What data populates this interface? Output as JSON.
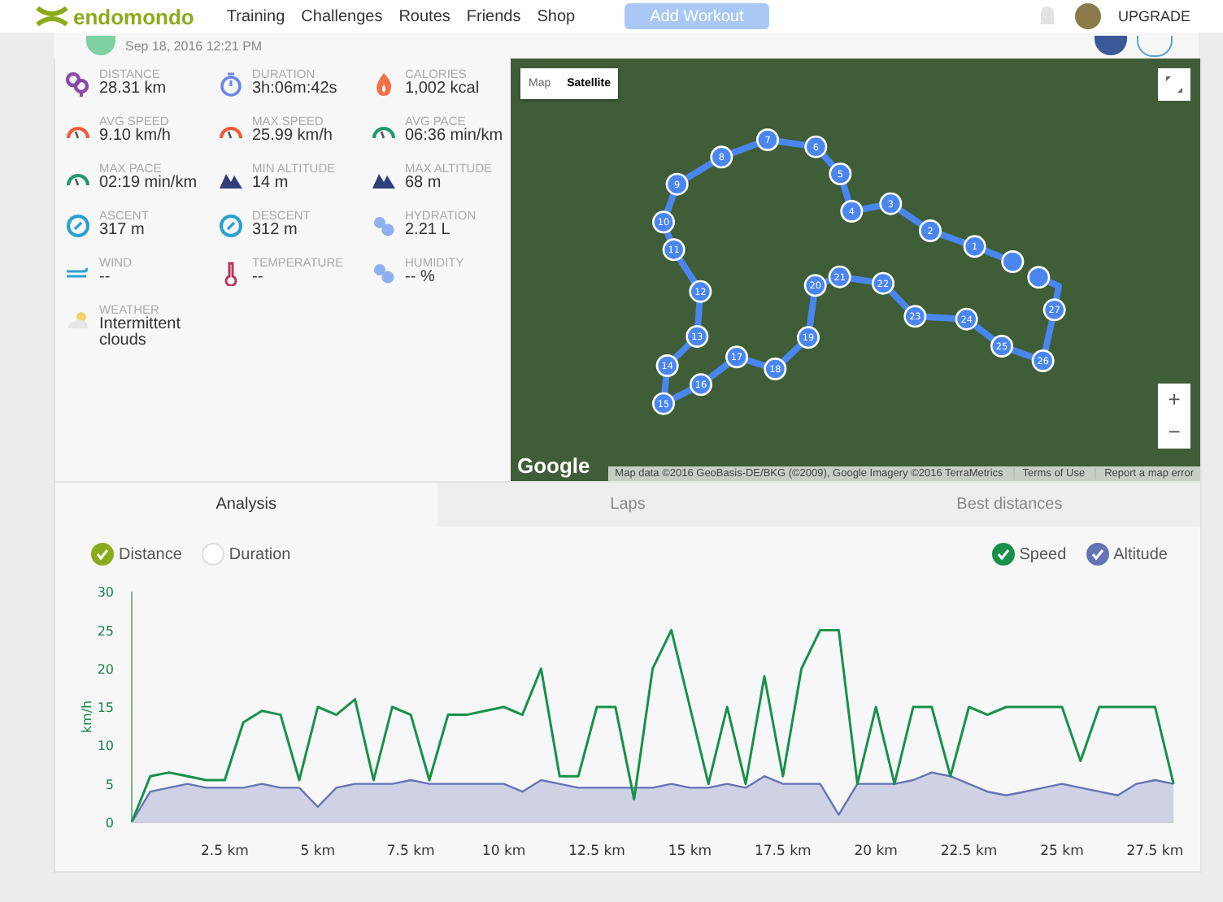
{
  "nav": {
    "logo": "endomondo",
    "links": [
      "Training",
      "Challenges",
      "Routes",
      "Friends",
      "Shop"
    ],
    "add_button": "Add Workout",
    "upgrade": "UPGRADE"
  },
  "header": {
    "date": "Sep 18, 2016 12:21 PM"
  },
  "stats": [
    {
      "label": "DISTANCE",
      "value": "28.31 km"
    },
    {
      "label": "DURATION",
      "value": "3h:06m:42s"
    },
    {
      "label": "CALORIES",
      "value": "1,002 kcal"
    },
    {
      "label": "AVG SPEED",
      "value": "9.10 km/h"
    },
    {
      "label": "MAX SPEED",
      "value": "25.99 km/h"
    },
    {
      "label": "AVG PACE",
      "value": "06:36 min/km"
    },
    {
      "label": "MAX PACE",
      "value": "02:19 min/km"
    },
    {
      "label": "MIN ALTITUDE",
      "value": "14 m"
    },
    {
      "label": "MAX ALTITUDE",
      "value": "68 m"
    },
    {
      "label": "ASCENT",
      "value": "317 m"
    },
    {
      "label": "DESCENT",
      "value": "312 m"
    },
    {
      "label": "HYDRATION",
      "value": "2.21 L"
    },
    {
      "label": "WIND",
      "value": "--"
    },
    {
      "label": "TEMPERATURE",
      "value": "--"
    },
    {
      "label": "HUMIDITY",
      "value": "-- %"
    },
    {
      "label": "WEATHER",
      "value": "Intermittent clouds"
    }
  ],
  "map": {
    "types": [
      {
        "label": "Map",
        "selected": false
      },
      {
        "label": "Satellite",
        "selected": true
      }
    ],
    "markers": [
      "1",
      "2",
      "3",
      "4",
      "5",
      "6",
      "7",
      "8",
      "9",
      "10",
      "11",
      "12",
      "13",
      "14",
      "15",
      "16",
      "17",
      "18",
      "19",
      "20",
      "21",
      "22",
      "23",
      "24",
      "25",
      "26",
      "27"
    ],
    "logo": "Google",
    "attribution": "Map data ©2016 GeoBasis-DE/BKG (©2009), Google Imagery ©2016 TerraMetrics",
    "terms": "Terms of Use",
    "report": "Report a map error",
    "zoom_in": "+",
    "zoom_out": "−"
  },
  "tabs": [
    {
      "label": "Analysis",
      "selected": true
    },
    {
      "label": "Laps",
      "selected": false
    },
    {
      "label": "Best distances",
      "selected": false
    }
  ],
  "x_toggles": [
    {
      "label": "Distance",
      "checked": true
    },
    {
      "label": "Duration",
      "checked": false
    }
  ],
  "series_toggles": [
    {
      "checked": true
    },
    {
      "checked": true
    }
  ],
  "chart": {
    "chart_data": {
      "type": "line",
      "ylabel": "km/h",
      "x": [
        0,
        0.5,
        1,
        1.5,
        2,
        2.5,
        3,
        3.5,
        4,
        4.5,
        5,
        5.5,
        6,
        6.5,
        7,
        7.5,
        8,
        8.5,
        9,
        9.5,
        10,
        10.5,
        11,
        11.5,
        12,
        12.5,
        13,
        13.5,
        14,
        14.5,
        15,
        15.5,
        16,
        16.5,
        17,
        17.5,
        18,
        18.5,
        19,
        19.5,
        20,
        20.5,
        21,
        21.5,
        22,
        22.5,
        23,
        23.5,
        24,
        24.5,
        25,
        25.5,
        26,
        26.5,
        27,
        27.5,
        28
      ],
      "series": [
        {
          "name": "Speed",
          "color": "#17914a",
          "values": [
            0,
            6,
            6.5,
            6,
            5.5,
            5.5,
            13,
            14.5,
            14,
            5.5,
            15,
            14,
            16,
            5.5,
            15,
            14,
            5.5,
            14,
            14,
            14.5,
            15,
            14,
            20,
            6,
            6,
            15,
            15,
            3,
            20,
            25,
            15,
            5,
            15,
            5,
            19,
            6,
            20,
            25,
            25,
            5,
            15,
            5,
            15,
            15,
            6,
            15,
            14,
            15,
            15,
            15,
            15,
            8,
            15,
            15,
            15,
            15,
            5
          ]
        },
        {
          "name": "Altitude",
          "color": "#6673b5",
          "values": [
            0,
            4,
            4.5,
            5,
            4.5,
            4.5,
            4.5,
            5,
            4.5,
            4.5,
            2,
            4.5,
            5,
            5,
            5,
            5.5,
            5,
            5,
            5,
            5,
            5,
            4,
            5.5,
            5,
            4.5,
            4.5,
            4.5,
            4.5,
            4.5,
            5,
            4.5,
            4.5,
            5,
            4.5,
            6,
            5,
            5,
            5,
            1,
            5,
            5,
            5,
            5.5,
            6.5,
            6,
            5,
            4,
            3.5,
            4,
            4.5,
            5,
            4.5,
            4,
            3.5,
            5,
            5.5,
            5
          ]
        }
      ],
      "xlim": [
        0,
        28
      ],
      "ylim": [
        0,
        30
      ],
      "yticks": [
        0,
        5,
        10,
        15,
        20,
        25,
        30
      ],
      "xticks": [
        {
          "value": 2.5,
          "label": "2.5 km"
        },
        {
          "value": 5,
          "label": "5 km"
        },
        {
          "value": 7.5,
          "label": "7.5 km"
        },
        {
          "value": 10,
          "label": "10 km"
        },
        {
          "value": 12.5,
          "label": "12.5 km"
        },
        {
          "value": 15,
          "label": "15 km"
        },
        {
          "value": 17.5,
          "label": "17.5 km"
        },
        {
          "value": 20,
          "label": "20 km"
        },
        {
          "value": 22.5,
          "label": "22.5 km"
        },
        {
          "value": 25,
          "label": "25 km"
        },
        {
          "value": 27.5,
          "label": "27.5 km"
        }
      ]
    }
  }
}
